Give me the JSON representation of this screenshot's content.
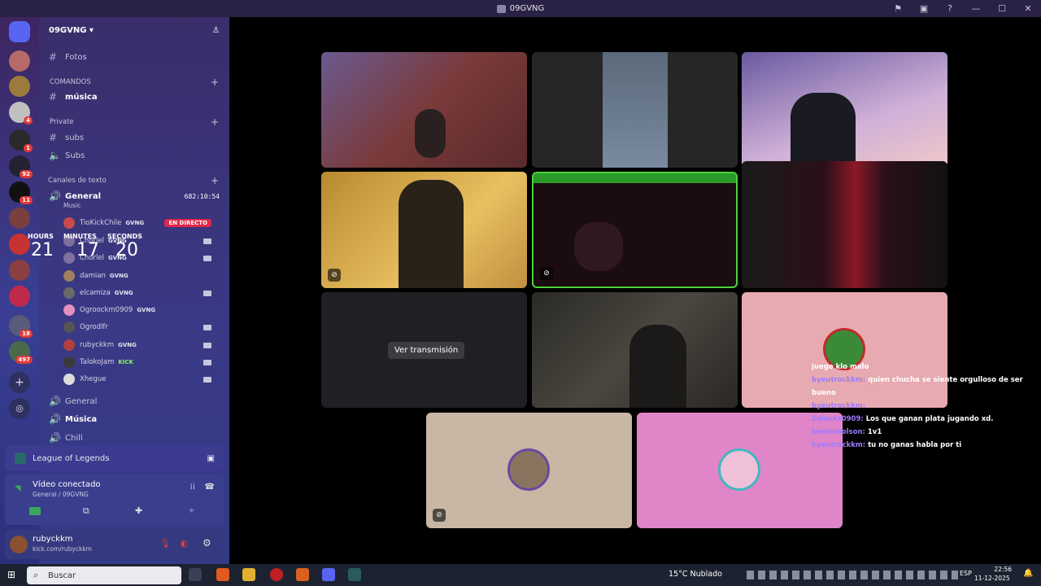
{
  "window": {
    "title": "09GVNG"
  },
  "server": {
    "name": "09GVNG"
  },
  "rail_badges": [
    "4",
    "1",
    "92",
    "11",
    "18",
    "497"
  ],
  "channels": {
    "fotos": "Fotos",
    "cat_comandos": "COMANDOS",
    "musica": "música",
    "cat_private": "Private",
    "subs_text": "subs",
    "subs_voice": "Subs",
    "cat_texto": "Canales de texto",
    "general_voice": "General",
    "general_timer": "682:10:54",
    "general_sub": "Music",
    "general1": "General",
    "musica_voice": "Música",
    "chill": "Chill"
  },
  "users": [
    {
      "name": "TioKickChile",
      "tag": "GVNG",
      "live": "EN DIRECTO"
    },
    {
      "name": "Chorlel",
      "tag": "GVNG"
    },
    {
      "name": "Chorlel",
      "tag": "GVNG"
    },
    {
      "name": "damian",
      "tag": "GVNG"
    },
    {
      "name": "elcamiza",
      "tag": "GVNG"
    },
    {
      "name": "Ogroockm0909",
      "tag": "GVNG"
    },
    {
      "name": "Ogrodlfr",
      "tag": ""
    },
    {
      "name": "rubyckkm",
      "tag": "GVNG"
    },
    {
      "name": "TalokoJam",
      "tag": "KICK"
    },
    {
      "name": "Xhegue",
      "tag": ""
    }
  ],
  "timer": {
    "hours_label": "HOURS",
    "hours": "21",
    "minutes_label": "MINUTES",
    "minutes": "17",
    "seconds_label": "SECONDS",
    "seconds": "20"
  },
  "activity": {
    "label": "League of Legends"
  },
  "voice": {
    "status": "Vídeo conectado",
    "location": "General / 09GVNG"
  },
  "user_panel": {
    "name": "rubyckkm",
    "status": "kick.com/rubyckkm"
  },
  "stage": {
    "ver_transmision": "Ver transmisión"
  },
  "chat": [
    {
      "user": "",
      "text": "juego klo malo"
    },
    {
      "user": "byeutrockkm:",
      "text": "quien chucha se siente orgulloso de ser bueno"
    },
    {
      "user": "byeutrockkm:",
      "text": ""
    },
    {
      "user": "Zelsoxx0909:",
      "text": "Los que ganan plata jugando xd."
    },
    {
      "user": "benitobolson:",
      "text": "1v1"
    },
    {
      "user": "byeutrockkm:",
      "text": "tu no ganas habla por ti"
    }
  ],
  "taskbar": {
    "search": "Buscar",
    "weather": "15°C  Nublado",
    "lang": "ESP",
    "time": "22:56",
    "date": "11-12-2025"
  },
  "colors": {
    "accent": "#5865f2",
    "live": "#e0284a",
    "kick": "#7cfc4c",
    "tile_pink": "#e7aab0",
    "tile_magenta": "#e085c8",
    "tile_beige": "#c9b7a6"
  }
}
